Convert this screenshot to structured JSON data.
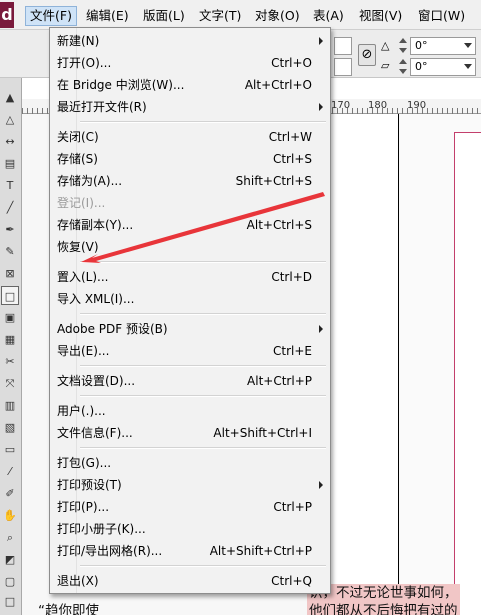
{
  "app": {
    "logo": "d"
  },
  "menubar": {
    "items": [
      {
        "label": "文件(F)",
        "active": true
      },
      {
        "label": "编辑(E)"
      },
      {
        "label": "版面(L)"
      },
      {
        "label": "文字(T)"
      },
      {
        "label": "对象(O)"
      },
      {
        "label": "表(A)"
      },
      {
        "label": "视图(V)"
      },
      {
        "label": "窗口(W)"
      }
    ]
  },
  "controlbar": {
    "angle_top": "0°",
    "angle_bottom": "0°"
  },
  "ruler": {
    "labels": [
      "170",
      "180",
      "190"
    ]
  },
  "document": {
    "highlight_line_1": "识，不过无论世事如何，",
    "highlight_line_2": "他们都从不后悔把有过的",
    "left_text": "“趋你即使"
  },
  "file_menu": {
    "groups": [
      [
        {
          "label": "新建(N)",
          "shortcut": "",
          "submenu": true
        },
        {
          "label": "打开(O)...",
          "shortcut": "Ctrl+O"
        },
        {
          "label": "在 Bridge 中浏览(W)...",
          "shortcut": "Alt+Ctrl+O"
        },
        {
          "label": "最近打开文件(R)",
          "shortcut": "",
          "submenu": true
        }
      ],
      [
        {
          "label": "关闭(C)",
          "shortcut": "Ctrl+W"
        },
        {
          "label": "存储(S)",
          "shortcut": "Ctrl+S"
        },
        {
          "label": "存储为(A)...",
          "shortcut": "Shift+Ctrl+S"
        },
        {
          "label": "登记(I)...",
          "shortcut": "",
          "disabled": true
        },
        {
          "label": "存储副本(Y)...",
          "shortcut": "Alt+Ctrl+S"
        },
        {
          "label": "恢复(V)",
          "shortcut": ""
        }
      ],
      [
        {
          "label": "置入(L)...",
          "shortcut": "Ctrl+D"
        },
        {
          "label": "导入 XML(I)...",
          "shortcut": ""
        }
      ],
      [
        {
          "label": "Adobe PDF 预设(B)",
          "shortcut": "",
          "submenu": true
        },
        {
          "label": "导出(E)...",
          "shortcut": "Ctrl+E"
        }
      ],
      [
        {
          "label": "文档设置(D)...",
          "shortcut": "Alt+Ctrl+P"
        }
      ],
      [
        {
          "label": "用户(.)...",
          "shortcut": ""
        },
        {
          "label": "文件信息(F)...",
          "shortcut": "Alt+Shift+Ctrl+I"
        }
      ],
      [
        {
          "label": "打包(G)...",
          "shortcut": ""
        },
        {
          "label": "打印预设(T)",
          "shortcut": "",
          "submenu": true
        },
        {
          "label": "打印(P)...",
          "shortcut": "Ctrl+P"
        },
        {
          "label": "打印小册子(K)...",
          "shortcut": ""
        },
        {
          "label": "打印/导出网格(R)...",
          "shortcut": "Alt+Shift+Ctrl+P"
        }
      ],
      [
        {
          "label": "退出(X)",
          "shortcut": "Ctrl+Q"
        }
      ]
    ]
  },
  "colors": {
    "arrow": "#e8353a",
    "menu_highlight": "#cfe3f7",
    "text_highlight": "#f1c6c6",
    "page_border": "#c33f6c"
  }
}
